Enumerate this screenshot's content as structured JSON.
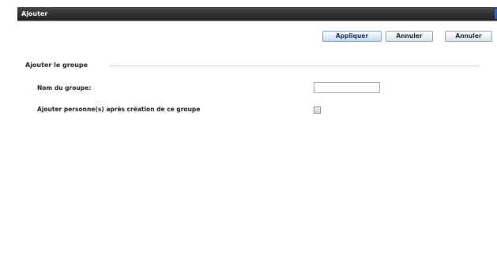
{
  "window": {
    "title": "Ajouter",
    "colors": {
      "titlebar": "#2f2f2f",
      "title_text": "#ffffff",
      "accent": "#2f66c7",
      "background": "#ffffff"
    }
  },
  "toolbar": {
    "apply_label": "Appliquer",
    "cancel_label_1": "Annuler",
    "cancel_label_2": "Annuler"
  },
  "section": {
    "title": "Ajouter le groupe"
  },
  "form": {
    "group_name_label": "Nom du groupe:",
    "group_name_value": "",
    "add_people_label": "Ajouter personne(s) après création de ce groupe",
    "add_people_checked": false
  }
}
